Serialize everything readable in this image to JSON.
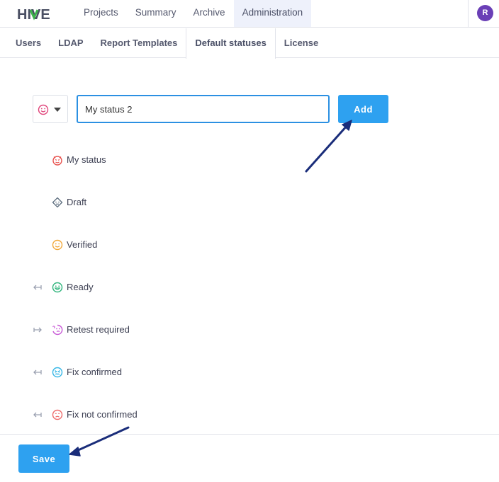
{
  "app": {
    "logo_text": "HIVE",
    "logo_colors": {
      "dark": "#4a4f63",
      "accent": "#3cb34a"
    }
  },
  "topnav": {
    "items": [
      {
        "label": "Projects",
        "active": false
      },
      {
        "label": "Summary",
        "active": false
      },
      {
        "label": "Archive",
        "active": false
      },
      {
        "label": "Administration",
        "active": true
      }
    ],
    "avatar_initial": "R",
    "avatar_color": "#6a3fb6"
  },
  "subtabs": [
    {
      "label": "Users",
      "active": false
    },
    {
      "label": "LDAP",
      "active": false
    },
    {
      "label": "Report Templates",
      "active": false
    },
    {
      "label": "Default statuses",
      "active": true
    },
    {
      "label": "License",
      "active": false
    }
  ],
  "add_form": {
    "icon_select": {
      "icon": "smiley-icon",
      "color": "#e0457b"
    },
    "input_value": "My status 2",
    "add_label": "Add"
  },
  "statuses": [
    {
      "label": "My status",
      "icon": "devil-smiley-icon",
      "color": "#e8534f",
      "transition_icon": null
    },
    {
      "label": "Draft",
      "icon": "draft-face-icon",
      "color": "#5a6b7c",
      "transition_icon": null
    },
    {
      "label": "Verified",
      "icon": "smiley-icon",
      "color": "#f2a93b",
      "transition_icon": null
    },
    {
      "label": "Ready",
      "icon": "grin-icon",
      "color": "#2fb47c",
      "transition_icon": "arrow-in-left-icon"
    },
    {
      "label": "Retest required",
      "icon": "thinking-face-icon",
      "color": "#c85ad6",
      "transition_icon": "arrow-in-right-icon"
    },
    {
      "label": "Fix confirmed",
      "icon": "confounded-face-icon",
      "color": "#35b6e6",
      "transition_icon": "arrow-in-left-icon"
    },
    {
      "label": "Fix not confirmed",
      "icon": "frown-icon",
      "color": "#ee6b6b",
      "transition_icon": "arrow-in-left-icon"
    }
  ],
  "footer": {
    "save_label": "Save"
  },
  "colors": {
    "primary_button": "#2ea1f0",
    "annotation_arrow": "#1a2d7a"
  }
}
